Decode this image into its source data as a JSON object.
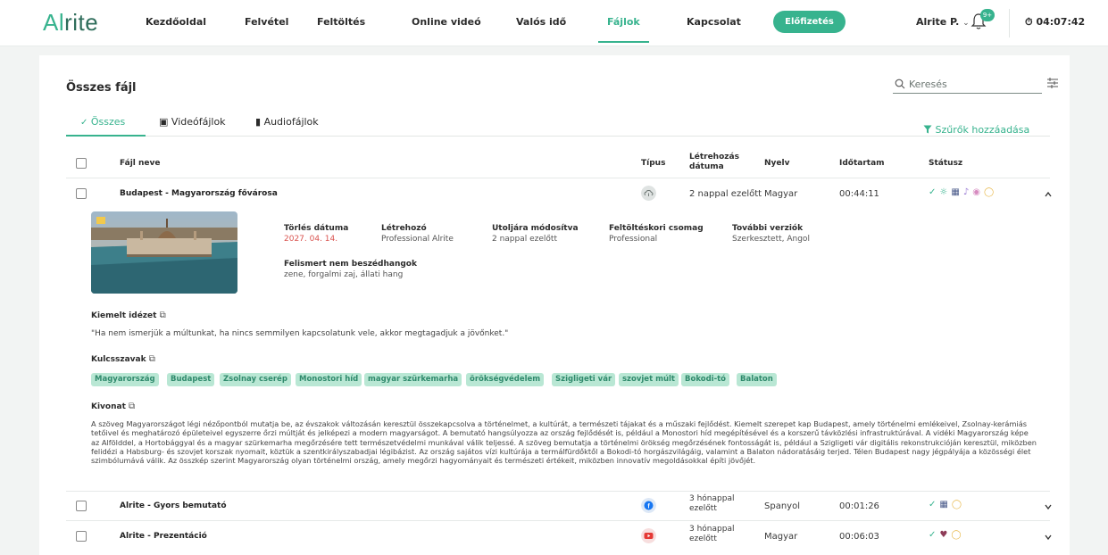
{
  "app": {
    "logo_a": "Al",
    "logo_b": "rite"
  },
  "nav": {
    "items": [
      "Kezdőoldal",
      "Felvétel",
      "Feltöltés",
      "Online videó",
      "Valós idő",
      "Fájlok",
      "Kapcsolat"
    ],
    "active": "Fájlok",
    "subscribe_label": "Előfizetés",
    "user_label": "Alrite P.",
    "notif_badge": "9+",
    "timer": "04:07:42"
  },
  "page": {
    "title": "Összes fájl",
    "search_placeholder": "Keresés",
    "tabs": [
      "Összes",
      "Videófájlok",
      "Audiofájlok"
    ],
    "add_filter_label": "Szűrők hozzáadása"
  },
  "table": {
    "headers": {
      "name": "Fájl neve",
      "type": "Típus",
      "created_a": "Létrehozás",
      "created_b": "dátuma",
      "language": "Nyelv",
      "duration": "Időtartam",
      "status": "Státusz"
    },
    "rows": [
      {
        "name": "Budapest - Magyarország fővárosa",
        "created": "2 nappal ezelőtt",
        "language": "Magyar",
        "duration": "00:44:11"
      },
      {
        "name": "Alrite - Gyors bemutató",
        "created_a": "3 hónappal",
        "created_b": "ezelőtt",
        "language": "Spanyol",
        "duration": "00:01:26"
      },
      {
        "name": "Alrite - Prezentáció",
        "created_a": "3 hónappal",
        "created_b": "ezelőtt",
        "language": "Magyar",
        "duration": "00:06:03"
      }
    ]
  },
  "detail": {
    "delete_label": "Törlés dátuma",
    "delete_value": "2027. 04. 14.",
    "creator_label": "Létrehozó",
    "creator_value": "Professional Alrite",
    "modified_label": "Utoljára módosítva",
    "modified_value": "2 nappal ezelőtt",
    "package_label": "Feltöltéskori csomag",
    "package_value": "Professional",
    "versions_label": "További verziók",
    "versions_value": "Szerkesztett, Angol",
    "nonspeech_label": "Felismert nem beszédhangok",
    "nonspeech_value": "zene, forgalmi zaj, állati hang",
    "quote_label": "Kiemelt idézet",
    "quote_text": "\"Ha nem ismerjük a múltunkat, ha nincs semmilyen kapcsolatunk vele, akkor megtagadjuk a jövőnket.\"",
    "keywords_label": "Kulcsszavak",
    "keywords": [
      "Magyarország",
      "Budapest",
      "Zsolnay cserép",
      "Monostori híd",
      "magyar szürkemarha",
      "örökségvédelem",
      "Szigligeti vár",
      "szovjet múlt",
      "Bokodi-tó",
      "Balaton"
    ],
    "summary_label": "Kivonat",
    "summary_text": "A szöveg Magyarországot légi nézőpontból mutatja be, az évszakok változásán keresztül összekapcsolva a történelmet, a kultúrát, a természeti tájakat és a műszaki fejlődést. Kiemelt szerepet kap Budapest, amely történelmi emlékeivel, Zsolnay-kerámiás tetőivel és meghatározó épületeivel egyszerre őrzi múltját és jelképezi a modern magyarságot. A bemutató hangsúlyozza az ország fejlődését is, például a Monostori híd megépítésével és a korszerű távközlési infrastruktúrával. A vidéki Magyarország képe az Alfölddel, a Hortobággyal és a magyar szürkemarha megőrzésére tett természetvédelmi munkával válik teljessé. A szöveg bemutatja a történelmi örökség megőrzésének fontosságát is, például a Szigligeti vár digitális rekonstrukcióján keresztül, miközben felidézi a Habsburg- és szovjet korszak nyomait, köztük a szentkirályszabadjai légibázist. Az ország sajátos vízi kultúrája a termálfürdőktől a Bokodi-tó horgászvilágáig, valamint a Balaton nádoratásáig terjed. Télen Budapest nagy jégpályája a közösségi élet szimbólumává válik. Az összkép szerint Magyarország olyan történelmi ország, amely megőrzi hagyományait és természeti értékeit, miközben innovatív megoldásokkal építi jövőjét."
  }
}
